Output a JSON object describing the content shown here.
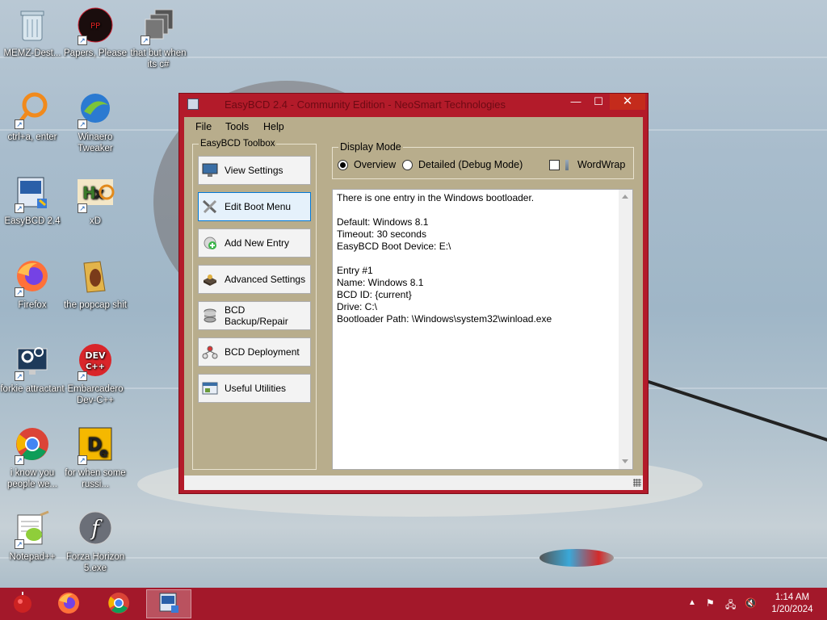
{
  "desktop": {
    "icons": [
      {
        "label": "MEMZ-Dest...",
        "icon": "recycle-bin-icon"
      },
      {
        "label": "Papers, Please",
        "icon": "papers-please-icon"
      },
      {
        "label": "that but when its c#",
        "icon": "folder-stack-icon"
      },
      {
        "label": "ctrl+a, enter",
        "icon": "magnifier-icon"
      },
      {
        "label": "Winaero Tweaker",
        "icon": "winaero-icon"
      },
      {
        "label": "EasyBCD 2.4",
        "icon": "easybcd-icon"
      },
      {
        "label": "xD",
        "icon": "hxd-icon"
      },
      {
        "label": "Firefox",
        "icon": "firefox-icon"
      },
      {
        "label": "the popcap shit",
        "icon": "popcap-folder-icon"
      },
      {
        "label": "forkie attractant",
        "icon": "settings-monitor-icon"
      },
      {
        "label": "Embarcadero Dev-C++",
        "icon": "devcpp-icon"
      },
      {
        "label": "i know you people we...",
        "icon": "chrome-icon"
      },
      {
        "label": "for when some russi...",
        "icon": "die-icon"
      },
      {
        "label": "Notepad++",
        "icon": "notepadpp-icon"
      },
      {
        "label": "Forza Horizon 5.exe",
        "icon": "flash-icon"
      }
    ]
  },
  "window": {
    "title": "EasyBCD 2.4 - Community Edition - NeoSmart Technologies",
    "minimize": "—",
    "maximize": "☐",
    "close": "✕",
    "menu": [
      "File",
      "Tools",
      "Help"
    ],
    "toolbox": {
      "legend": "EasyBCD Toolbox",
      "buttons": [
        {
          "label": "View Settings",
          "icon": "monitor-icon"
        },
        {
          "label": "Edit Boot Menu",
          "icon": "tools-icon"
        },
        {
          "label": "Add New Entry",
          "icon": "add-entry-icon"
        },
        {
          "label": "Advanced Settings",
          "icon": "gear-box-icon"
        },
        {
          "label": "BCD Backup/Repair",
          "icon": "database-icon"
        },
        {
          "label": "BCD Deployment",
          "icon": "deploy-icon"
        },
        {
          "label": "Useful Utilities",
          "icon": "utilities-icon"
        }
      ]
    },
    "display_mode": {
      "legend": "Display Mode",
      "overview": "Overview",
      "detailed": "Detailed (Debug Mode)",
      "wordwrap": "WordWrap",
      "selected": "overview"
    },
    "output_lines": [
      "There is one entry in the Windows bootloader.",
      "",
      "Default: Windows 8.1",
      "Timeout: 30 seconds",
      "EasyBCD Boot Device: E:\\",
      "",
      "Entry #1",
      "Name: Windows 8.1",
      "BCD ID: {current}",
      "Drive: C:\\",
      "Bootloader Path: \\Windows\\system32\\winload.exe"
    ]
  },
  "taskbar": {
    "clock_time": "1:14 AM",
    "clock_date": "1/20/2024",
    "apps": [
      "start-orb-icon",
      "firefox-icon",
      "chrome-icon",
      "easybcd-icon"
    ]
  },
  "colors": {
    "titlebar": "#b31b2a",
    "taskbar": "#a3182a",
    "client": "#b8ad8c"
  }
}
